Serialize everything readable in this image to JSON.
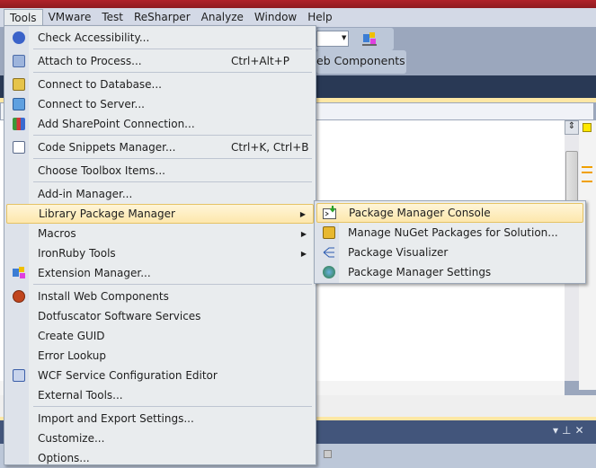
{
  "menubar": {
    "items": [
      "Tools",
      "VMware",
      "Test",
      "ReSharper",
      "Analyze",
      "Window",
      "Help"
    ]
  },
  "toolbar": {
    "web_components_label": "eb Components"
  },
  "tools_menu": {
    "items": [
      {
        "label": "Check Accessibility...",
        "icon": "accessibility-icon",
        "shortcut": ""
      },
      {
        "label": "Attach to Process...",
        "icon": "attach-process-icon",
        "shortcut": "Ctrl+Alt+P"
      },
      {
        "label": "Connect to Database...",
        "icon": "database-icon",
        "shortcut": ""
      },
      {
        "label": "Connect to Server...",
        "icon": "server-icon",
        "shortcut": ""
      },
      {
        "label": "Add SharePoint Connection...",
        "icon": "sharepoint-icon",
        "shortcut": ""
      },
      {
        "label": "Code Snippets Manager...",
        "icon": "code-snippets-icon",
        "shortcut": "Ctrl+K, Ctrl+B"
      },
      {
        "label": "Choose Toolbox Items...",
        "shortcut": ""
      },
      {
        "label": "Add-in Manager...",
        "shortcut": ""
      },
      {
        "label": "Library Package Manager",
        "submenu": true
      },
      {
        "label": "Macros",
        "submenu": true
      },
      {
        "label": "IronRuby Tools",
        "submenu": true
      },
      {
        "label": "Extension Manager...",
        "icon": "extension-manager-icon"
      },
      {
        "label": "Install Web Components",
        "icon": "install-icon"
      },
      {
        "label": "Dotfuscator Software Services"
      },
      {
        "label": "Create GUID"
      },
      {
        "label": "Error Lookup"
      },
      {
        "label": "WCF Service Configuration Editor",
        "icon": "wcf-icon"
      },
      {
        "label": "External Tools..."
      },
      {
        "label": "Import and Export Settings..."
      },
      {
        "label": "Customize..."
      },
      {
        "label": "Options..."
      }
    ]
  },
  "submenu": {
    "items": [
      {
        "label": "Package Manager Console",
        "icon": "console-icon"
      },
      {
        "label": "Manage NuGet Packages for Solution...",
        "icon": "package-icon"
      },
      {
        "label": "Package Visualizer",
        "icon": "visualizer-icon"
      },
      {
        "label": "Package Manager Settings",
        "icon": "settings-icon"
      }
    ]
  },
  "colors": {
    "highlight": "#fde7ac",
    "menu_bg": "#e9ecee",
    "title_bar": "#b0222a"
  }
}
